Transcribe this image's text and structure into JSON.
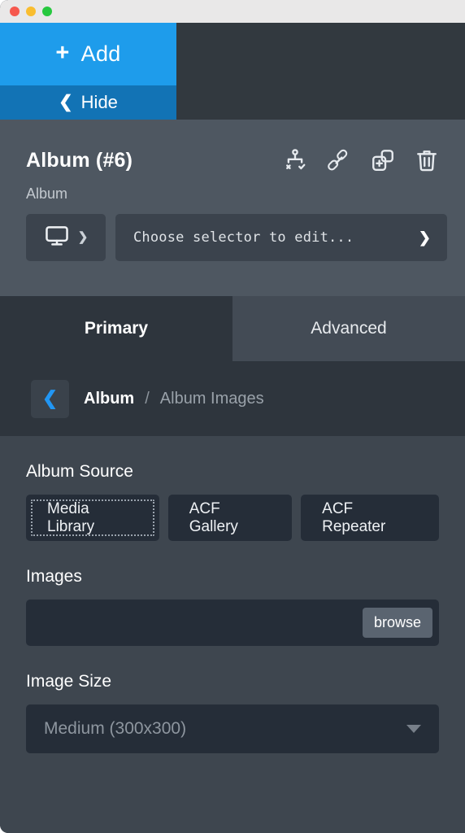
{
  "titlebar": {
    "lights": [
      "close-red",
      "minimize-yellow",
      "zoom-green"
    ]
  },
  "toppanel": {
    "add_label": "Add",
    "add_icon": "plus-icon",
    "hide_label": "Hide",
    "hide_icon": "chevron-left-icon",
    "add_color": "#1e9ceb",
    "hide_color": "#1273b5"
  },
  "header": {
    "title": "Album (#6)",
    "subtitle": "Album",
    "icons": [
      {
        "name": "sitemap-validate-icon",
        "title": ""
      },
      {
        "name": "link-icon",
        "title": ""
      },
      {
        "name": "duplicate-add-icon",
        "title": ""
      },
      {
        "name": "trash-icon",
        "title": ""
      }
    ],
    "device": {
      "icon": "desktop-monitor-icon",
      "caret": "chevron-down-icon"
    },
    "selector": {
      "value": "Choose selector to edit...",
      "caret": "chevron-down-icon"
    },
    "background": "#4e5761"
  },
  "tabs": [
    {
      "label": "Primary",
      "active": true
    },
    {
      "label": "Advanced",
      "active": false
    }
  ],
  "breadcrumb": {
    "back_icon": "chevron-left-icon",
    "current": "Album",
    "separator": "/",
    "parent": "Album Images",
    "accent": "#2196f3"
  },
  "main": {
    "album_source": {
      "label": "Album Source",
      "options": [
        {
          "label": "Media Library",
          "selected": true
        },
        {
          "label": "ACF Gallery",
          "selected": false
        },
        {
          "label": "ACF Repeater",
          "selected": false
        }
      ]
    },
    "images": {
      "label": "Images",
      "value": "",
      "placeholder": "",
      "browse_label": "browse"
    },
    "image_size": {
      "label": "Image Size",
      "value": "Medium (300x300)",
      "caret": "caret-down-icon"
    }
  }
}
